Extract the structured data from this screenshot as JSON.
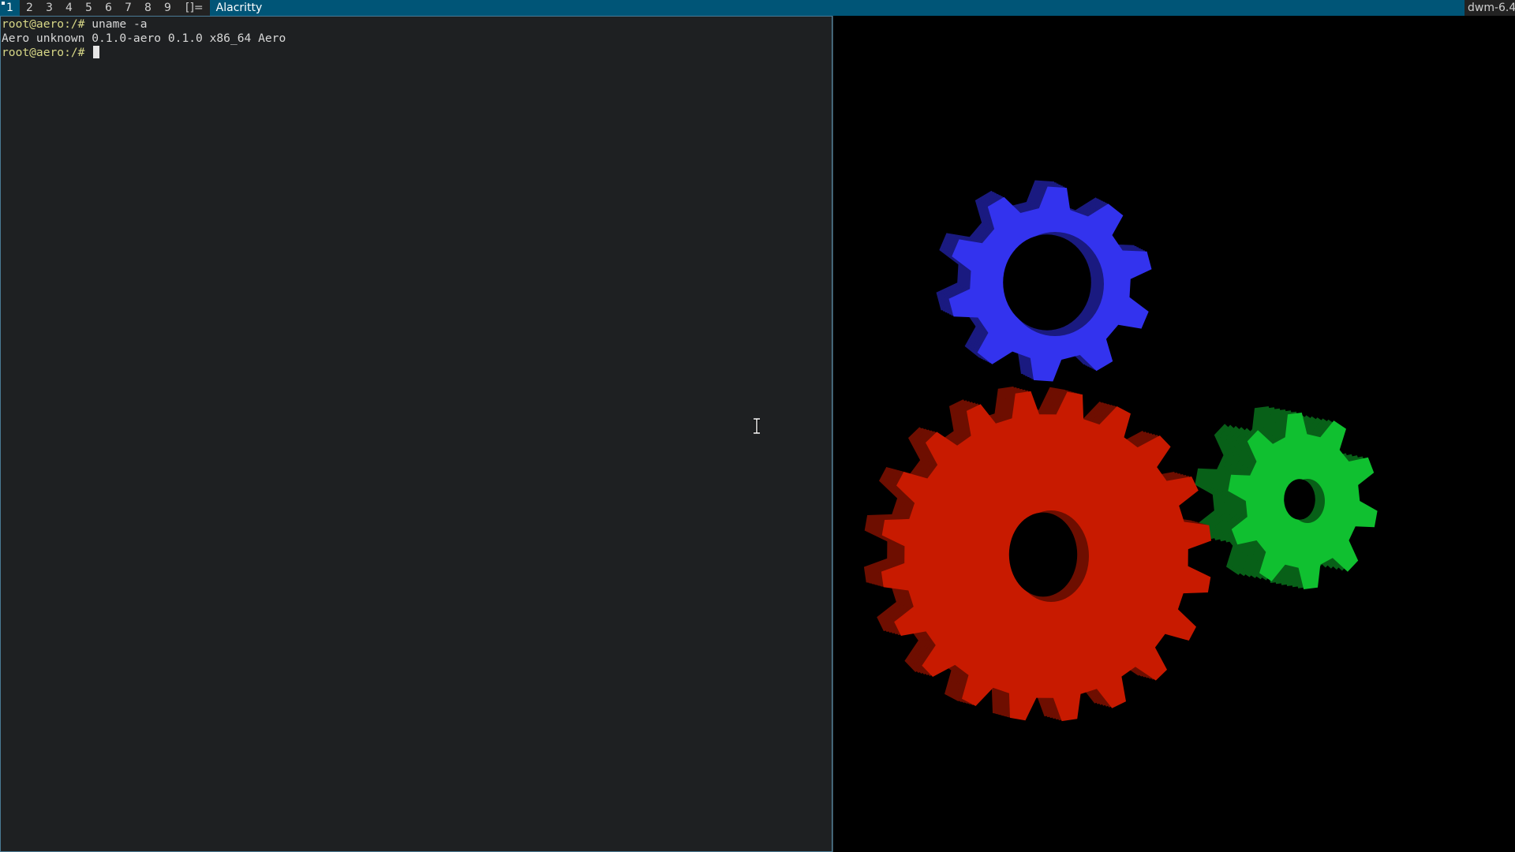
{
  "bar": {
    "tags": [
      "1",
      "2",
      "3",
      "4",
      "5",
      "6",
      "7",
      "8",
      "9"
    ],
    "active_tag": 0,
    "layout_symbol": "[]=",
    "window_title": "Alacritty",
    "status": "dwm-6.4"
  },
  "terminal": {
    "lines": [
      {
        "prompt": "root@aero:/#",
        "text": " uname -a"
      },
      {
        "prompt": "",
        "text": "Aero unknown 0.1.0-aero 0.1.0 x86_64 Aero"
      },
      {
        "prompt": "root@aero:/#",
        "text": " ",
        "cursor": true
      }
    ]
  },
  "gears": {
    "items": [
      {
        "name": "red-gear",
        "color": "#c81a00",
        "side_color": "#6e0e00",
        "teeth": 20
      },
      {
        "name": "blue-gear",
        "color": "#3333ee",
        "side_color": "#1a1a80",
        "teeth": 10
      },
      {
        "name": "green-gear",
        "color": "#10c030",
        "side_color": "#086018",
        "teeth": 10
      }
    ]
  },
  "colors": {
    "bar_bg": "#222222",
    "accent": "#005577",
    "terminal_bg": "#1e2022",
    "prompt": "#d7d787",
    "text": "#d8d8d8"
  }
}
